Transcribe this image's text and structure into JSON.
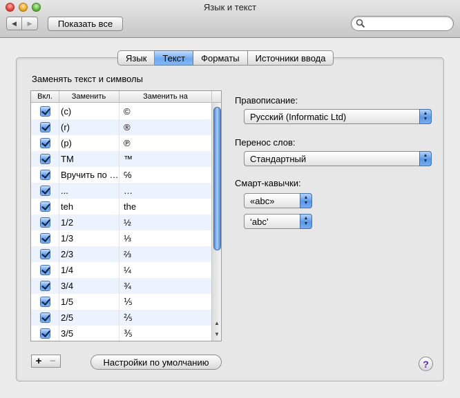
{
  "window": {
    "title": "Язык и текст"
  },
  "toolbar": {
    "back_glyph": "◀",
    "forward_glyph": "▶",
    "show_all_label": "Показать все",
    "search_value": "",
    "search_icon": "search-icon"
  },
  "tabs": [
    {
      "label": "Язык",
      "active": false
    },
    {
      "label": "Текст",
      "active": true
    },
    {
      "label": "Форматы",
      "active": false
    },
    {
      "label": "Источники ввода",
      "active": false
    }
  ],
  "text_tab": {
    "section_label": "Заменять текст и символы",
    "columns": {
      "enabled": "Вкл.",
      "replace": "Заменить",
      "with": "Заменить на"
    },
    "rows": [
      {
        "enabled": true,
        "replace": "(c)",
        "with": "©"
      },
      {
        "enabled": true,
        "replace": "(r)",
        "with": "®"
      },
      {
        "enabled": true,
        "replace": "(p)",
        "with": "℗"
      },
      {
        "enabled": true,
        "replace": "TM",
        "with": "™"
      },
      {
        "enabled": true,
        "replace": "Вручить по …",
        "with": "℅"
      },
      {
        "enabled": true,
        "replace": "...",
        "with": "…"
      },
      {
        "enabled": true,
        "replace": "teh",
        "with": "the"
      },
      {
        "enabled": true,
        "replace": "1/2",
        "with": "½"
      },
      {
        "enabled": true,
        "replace": "1/3",
        "with": "⅓"
      },
      {
        "enabled": true,
        "replace": "2/3",
        "with": "⅔"
      },
      {
        "enabled": true,
        "replace": "1/4",
        "with": "¼"
      },
      {
        "enabled": true,
        "replace": "3/4",
        "with": "¾"
      },
      {
        "enabled": true,
        "replace": "1/5",
        "with": "⅕"
      },
      {
        "enabled": true,
        "replace": "2/5",
        "with": "⅖"
      },
      {
        "enabled": true,
        "replace": "3/5",
        "with": "⅗"
      }
    ],
    "add_label": "+",
    "remove_label": "−",
    "defaults_button_label": "Настройки по умолчанию",
    "spelling": {
      "label": "Правописание:",
      "value": "Русский (Informatic Ltd)"
    },
    "hyphenation": {
      "label": "Перенос слов:",
      "value": "Стандартный"
    },
    "smart_quotes": {
      "label": "Смарт-кавычки:",
      "double_value": "«abc»",
      "single_value": "‘abc’"
    },
    "help_label": "?"
  },
  "colors": {
    "selection_blue": "#6fa9ef",
    "row_alt": "#edf3fe",
    "window_bg": "#ececec"
  }
}
